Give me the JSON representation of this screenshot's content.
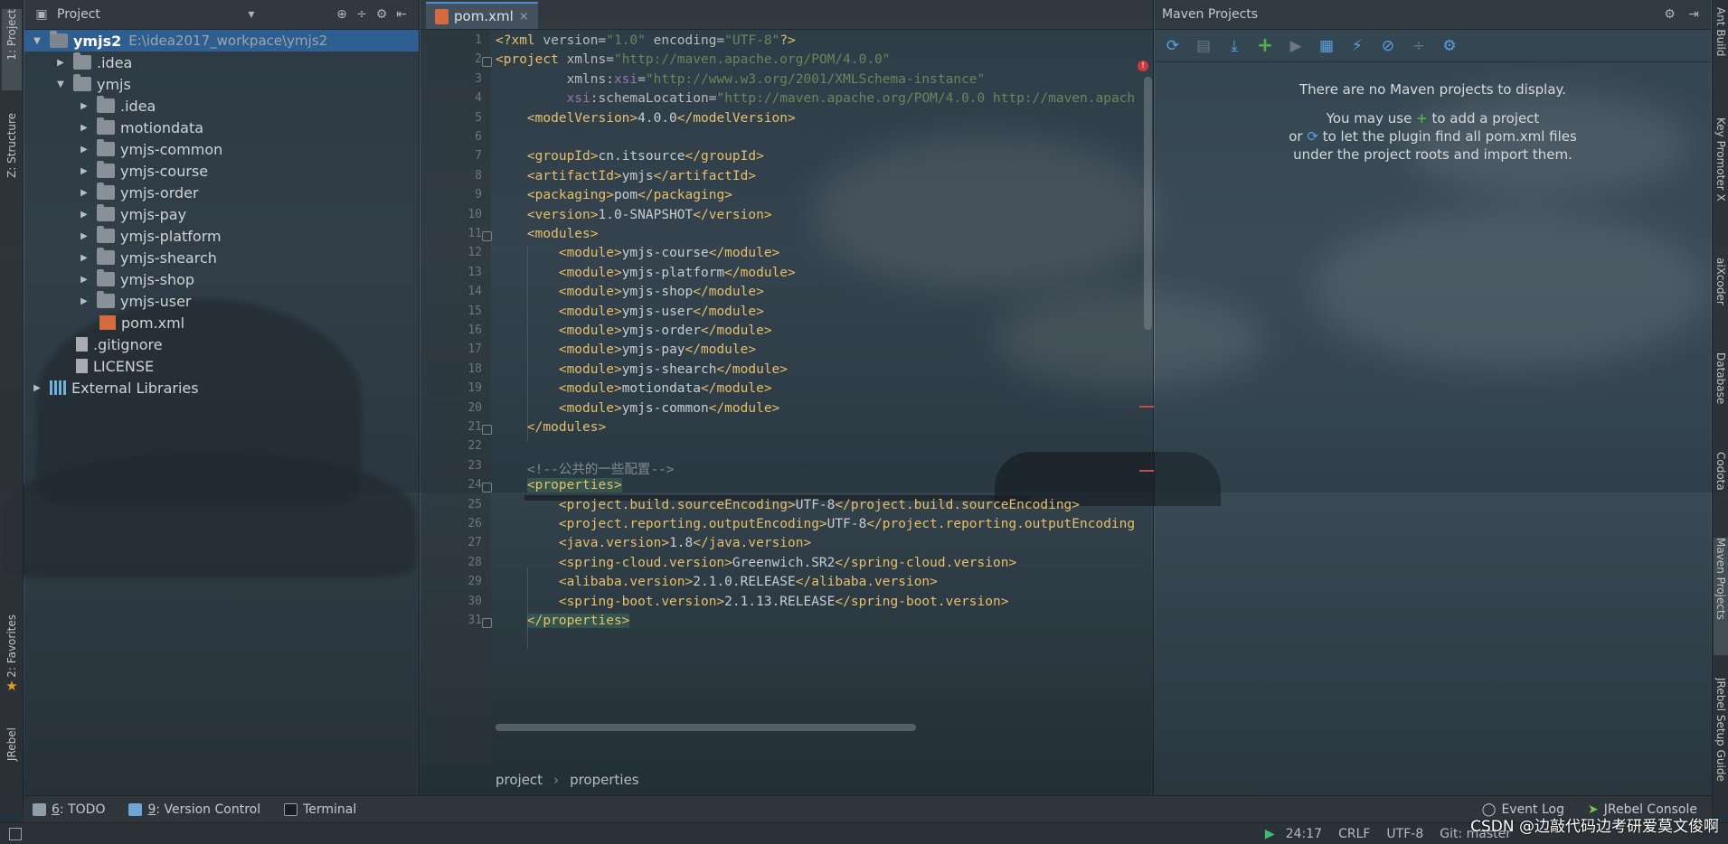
{
  "left_strip": {
    "tabs": [
      {
        "label": "1: Project",
        "active": true
      },
      {
        "label": "Z: Structure",
        "active": false
      },
      {
        "label": "2: Favorites",
        "active": false
      },
      {
        "label": "JRebel",
        "active": false
      }
    ]
  },
  "project_panel": {
    "title": "Project",
    "tree": [
      {
        "label": "ymjs2",
        "path": "E:\\idea2017_workpace\\ymjs2",
        "depth": 0,
        "arrow": "down",
        "icon": "folder-module",
        "selected": true,
        "bold": true
      },
      {
        "label": ".idea",
        "depth": 1,
        "arrow": "right",
        "icon": "folder"
      },
      {
        "label": "ymjs",
        "depth": 1,
        "arrow": "down",
        "icon": "folder"
      },
      {
        "label": ".idea",
        "depth": 2,
        "arrow": "right",
        "icon": "folder"
      },
      {
        "label": "motiondata",
        "depth": 2,
        "arrow": "right",
        "icon": "folder"
      },
      {
        "label": "ymjs-common",
        "depth": 2,
        "arrow": "right",
        "icon": "folder"
      },
      {
        "label": "ymjs-course",
        "depth": 2,
        "arrow": "right",
        "icon": "folder"
      },
      {
        "label": "ymjs-order",
        "depth": 2,
        "arrow": "right",
        "icon": "folder"
      },
      {
        "label": "ymjs-pay",
        "depth": 2,
        "arrow": "right",
        "icon": "folder"
      },
      {
        "label": "ymjs-platform",
        "depth": 2,
        "arrow": "right",
        "icon": "folder"
      },
      {
        "label": "ymjs-shearch",
        "depth": 2,
        "arrow": "right",
        "icon": "folder"
      },
      {
        "label": "ymjs-shop",
        "depth": 2,
        "arrow": "right",
        "icon": "folder"
      },
      {
        "label": "ymjs-user",
        "depth": 2,
        "arrow": "right",
        "icon": "folder"
      },
      {
        "label": "pom.xml",
        "depth": 2,
        "arrow": "none",
        "icon": "xml-file"
      },
      {
        "label": ".gitignore",
        "depth": 1,
        "arrow": "none",
        "icon": "file"
      },
      {
        "label": "LICENSE",
        "depth": 1,
        "arrow": "none",
        "icon": "file"
      },
      {
        "label": "External Libraries",
        "depth": 0,
        "arrow": "right",
        "icon": "libraries"
      }
    ]
  },
  "editor": {
    "tab": {
      "label": "pom.xml",
      "close": "×"
    },
    "lines": [
      [
        {
          "t": "<?xml ",
          "c": "tag"
        },
        {
          "t": "version=",
          "c": "attr"
        },
        {
          "t": "\"1.0\"",
          "c": "val"
        },
        {
          "t": " encoding=",
          "c": "attr"
        },
        {
          "t": "\"UTF-8\"",
          "c": "val"
        },
        {
          "t": "?>",
          "c": "tag"
        }
      ],
      [
        {
          "t": "<project ",
          "c": "tag"
        },
        {
          "t": "xmlns=",
          "c": "attr"
        },
        {
          "t": "\"http://maven.apache.org/POM/4.0.0\"",
          "c": "val"
        }
      ],
      [
        {
          "t": "         xmlns:",
          "c": "attr"
        },
        {
          "t": "xsi",
          "c": "ns"
        },
        {
          "t": "=",
          "c": "attr"
        },
        {
          "t": "\"http://www.w3.org/2001/XMLSchema-instance\"",
          "c": "val"
        }
      ],
      [
        {
          "t": "         ",
          "c": "attr"
        },
        {
          "t": "xsi",
          "c": "ns"
        },
        {
          "t": ":schemaLocation=",
          "c": "attr"
        },
        {
          "t": "\"http://maven.apache.org/POM/4.0.0 http://maven.apach",
          "c": "val"
        }
      ],
      [
        {
          "t": "    <modelVersion>",
          "c": "tag"
        },
        {
          "t": "4.0.0",
          "c": "text"
        },
        {
          "t": "</modelVersion>",
          "c": "tag"
        }
      ],
      [
        {
          "t": "",
          "c": "text"
        }
      ],
      [
        {
          "t": "    <groupId>",
          "c": "tag"
        },
        {
          "t": "cn.itsource",
          "c": "text"
        },
        {
          "t": "</groupId>",
          "c": "tag"
        }
      ],
      [
        {
          "t": "    <artifactId>",
          "c": "tag"
        },
        {
          "t": "ymjs",
          "c": "text"
        },
        {
          "t": "</artifactId>",
          "c": "tag"
        }
      ],
      [
        {
          "t": "    <packaging>",
          "c": "tag"
        },
        {
          "t": "pom",
          "c": "text"
        },
        {
          "t": "</packaging>",
          "c": "tag"
        }
      ],
      [
        {
          "t": "    <version>",
          "c": "tag"
        },
        {
          "t": "1.0-SNAPSHOT",
          "c": "text"
        },
        {
          "t": "</version>",
          "c": "tag"
        }
      ],
      [
        {
          "t": "    <modules>",
          "c": "tag"
        }
      ],
      [
        {
          "t": "        <module>",
          "c": "tag"
        },
        {
          "t": "ymjs-course",
          "c": "text"
        },
        {
          "t": "</module>",
          "c": "tag"
        }
      ],
      [
        {
          "t": "        <module>",
          "c": "tag"
        },
        {
          "t": "ymjs-platform",
          "c": "text"
        },
        {
          "t": "</module>",
          "c": "tag"
        }
      ],
      [
        {
          "t": "        <module>",
          "c": "tag"
        },
        {
          "t": "ymjs-shop",
          "c": "text"
        },
        {
          "t": "</module>",
          "c": "tag"
        }
      ],
      [
        {
          "t": "        <module>",
          "c": "tag"
        },
        {
          "t": "ymjs-user",
          "c": "text"
        },
        {
          "t": "</module>",
          "c": "tag"
        }
      ],
      [
        {
          "t": "        <module>",
          "c": "tag"
        },
        {
          "t": "ymjs-order",
          "c": "text"
        },
        {
          "t": "</module>",
          "c": "tag"
        }
      ],
      [
        {
          "t": "        <module>",
          "c": "tag"
        },
        {
          "t": "ymjs-pay",
          "c": "text"
        },
        {
          "t": "</module>",
          "c": "tag"
        }
      ],
      [
        {
          "t": "        <module>",
          "c": "tag"
        },
        {
          "t": "ymjs-shearch",
          "c": "text"
        },
        {
          "t": "</module>",
          "c": "tag"
        }
      ],
      [
        {
          "t": "        <module>",
          "c": "tag"
        },
        {
          "t": "motiondata",
          "c": "text"
        },
        {
          "t": "</module>",
          "c": "tag"
        }
      ],
      [
        {
          "t": "        <module>",
          "c": "tag"
        },
        {
          "t": "ymjs-common",
          "c": "text"
        },
        {
          "t": "</module>",
          "c": "tag"
        }
      ],
      [
        {
          "t": "    </modules>",
          "c": "tag"
        }
      ],
      [
        {
          "t": "",
          "c": "text"
        }
      ],
      [
        {
          "t": "    <!--公共的一些配置-->",
          "c": "comment"
        }
      ],
      [
        {
          "t": "    ",
          "c": "text"
        },
        {
          "t": "<properties>",
          "c": "taghl"
        }
      ],
      [
        {
          "t": "        <project.build.sourceEncoding>",
          "c": "tag"
        },
        {
          "t": "UTF-8",
          "c": "text"
        },
        {
          "t": "</project.build.sourceEncoding>",
          "c": "tag"
        }
      ],
      [
        {
          "t": "        <project.reporting.outputEncoding>",
          "c": "tag"
        },
        {
          "t": "UTF-8",
          "c": "text"
        },
        {
          "t": "</project.reporting.outputEncoding",
          "c": "tag"
        }
      ],
      [
        {
          "t": "        <java.version>",
          "c": "tag"
        },
        {
          "t": "1.8",
          "c": "text"
        },
        {
          "t": "</java.version>",
          "c": "tag"
        }
      ],
      [
        {
          "t": "        <spring-cloud.version>",
          "c": "tag"
        },
        {
          "t": "Greenwich.SR2",
          "c": "text"
        },
        {
          "t": "</spring-cloud.version>",
          "c": "tag"
        }
      ],
      [
        {
          "t": "        <alibaba.version>",
          "c": "tag"
        },
        {
          "t": "2.1.0.RELEASE",
          "c": "text"
        },
        {
          "t": "</alibaba.version>",
          "c": "tag"
        }
      ],
      [
        {
          "t": "        <spring-boot.version>",
          "c": "tag"
        },
        {
          "t": "2.1.13.RELEASE",
          "c": "text"
        },
        {
          "t": "</spring-boot.version>",
          "c": "tag"
        }
      ],
      [
        {
          "t": "    ",
          "c": "text"
        },
        {
          "t": "</properties>",
          "c": "taghl"
        }
      ]
    ],
    "line_numbers": [
      "1",
      "2",
      "3",
      "4",
      "5",
      "6",
      "7",
      "8",
      "9",
      "10",
      "11",
      "12",
      "13",
      "14",
      "15",
      "16",
      "17",
      "18",
      "19",
      "20",
      "21",
      "22",
      "23",
      "24",
      "25",
      "26",
      "27",
      "28",
      "29",
      "30",
      "31"
    ],
    "breadcrumb": [
      "project",
      "properties"
    ],
    "breadcrumb_sep": "›"
  },
  "maven": {
    "title": "Maven Projects",
    "message_line1": "There are no Maven projects to display.",
    "message_line2_pre": "You may use",
    "message_line2_post": "to add a project",
    "message_line3_pre": "or",
    "message_line3_post": "to let the plugin find all pom.xml files",
    "message_line4": "under the project roots and import them."
  },
  "right_strip": {
    "tabs": [
      {
        "label": "Ant Build"
      },
      {
        "label": "Key Promoter X"
      },
      {
        "label": "aiXcoder"
      },
      {
        "label": "Database"
      },
      {
        "label": "Codota"
      },
      {
        "label": "Maven Projects",
        "active": true
      },
      {
        "label": "JRebel Setup Guide"
      }
    ]
  },
  "bottom_tools": {
    "todo": {
      "num": "6",
      "label": ": TODO"
    },
    "vcs": {
      "num": "9",
      "label": ": Version Control"
    },
    "terminal": "Terminal",
    "event_log": "Event Log",
    "jrebel_console": "JRebel Console"
  },
  "status_bar": {
    "position": "24:17",
    "line_sep": "CRLF",
    "encoding": "UTF-8",
    "git": "Git: master"
  },
  "watermark": "CSDN @边敲代码边考研爱莫文俊啊",
  "colors": {
    "selection": "#2f659e",
    "xml_tag": "#e8bf6a",
    "xml_value": "#6a8759",
    "accent_blue": "#5aa0e0",
    "accent_green": "#4caf50"
  }
}
